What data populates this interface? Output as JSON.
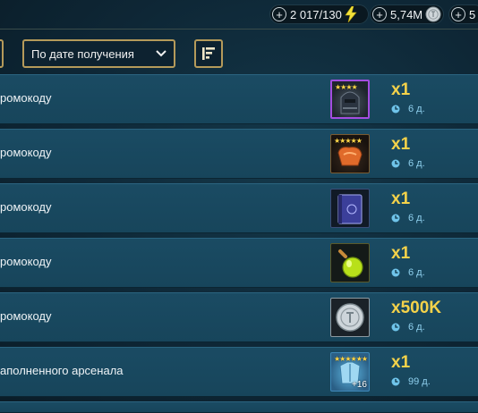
{
  "resources": {
    "energy": {
      "value": "2 017/130",
      "icon": "lightning-icon"
    },
    "silver": {
      "value": "5,74M",
      "icon": "silver-coin-icon"
    },
    "gems": {
      "value": "5"
    }
  },
  "toolbar": {
    "sort_label": "По дате получения",
    "filter_icon": "sort-filter-icon"
  },
  "rows": [
    {
      "title": "ромокоду",
      "qty": "x1",
      "time": "6 д.",
      "icon": "epic-artifact-helmet-icon",
      "stars": "★★★★",
      "frame": "#a44de0"
    },
    {
      "title": "ромокоду",
      "qty": "x1",
      "time": "6 д.",
      "icon": "orange-gauntlet-icon",
      "stars": "★★★★★",
      "frame": "#7a5a30"
    },
    {
      "title": "ромокоду",
      "qty": "x1",
      "time": "6 д.",
      "icon": "skill-tome-icon",
      "stars": "",
      "frame": "#3a4d78"
    },
    {
      "title": "ромокоду",
      "qty": "x1",
      "time": "6 д.",
      "icon": "xp-potion-icon",
      "stars": "",
      "frame": "#5a5a2a"
    },
    {
      "title": "ромокоду",
      "qty": "x500K",
      "time": "6 д.",
      "icon": "silver-coin-icon",
      "stars": "",
      "frame": "#8c9aa2"
    },
    {
      "title": "аполненного арсенала",
      "qty": "x1",
      "time": "99 д.",
      "icon": "legendary-armor-icon",
      "stars": "★★★★★★",
      "badge": "+16",
      "frame": "#3e88b8"
    }
  ]
}
